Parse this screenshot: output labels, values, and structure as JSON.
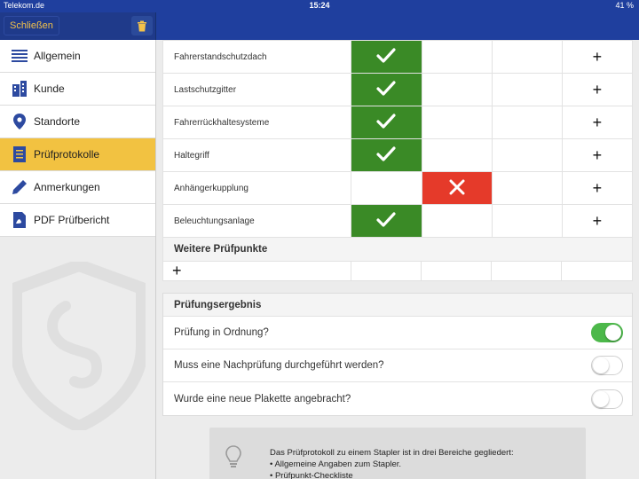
{
  "status": {
    "carrier": "Telekom.de",
    "time": "15:24",
    "battery": "41 %"
  },
  "nav": {
    "close_label": "Schließen"
  },
  "sidebar": {
    "items": [
      {
        "label": "Allgemein",
        "icon": "list-icon"
      },
      {
        "label": "Kunde",
        "icon": "building-icon"
      },
      {
        "label": "Standorte",
        "icon": "location-pin-icon"
      },
      {
        "label": "Prüfprotokolle",
        "icon": "document-icon",
        "active": true
      },
      {
        "label": "Anmerkungen",
        "icon": "pencil-icon"
      },
      {
        "label": "PDF Prüfbericht",
        "icon": "pdf-icon"
      }
    ]
  },
  "checklist": {
    "rows": [
      {
        "name": "Fahrerstandschutzdach",
        "result": "ok"
      },
      {
        "name": "Lastschutzgitter",
        "result": "ok"
      },
      {
        "name": "Fahrerrückhaltesysteme",
        "result": "ok"
      },
      {
        "name": "Haltegriff",
        "result": "ok"
      },
      {
        "name": "Anhängerkupplung",
        "result": "nok"
      },
      {
        "name": "Beleuchtungsanlage",
        "result": "ok"
      }
    ],
    "add_symbol": "+"
  },
  "extra": {
    "title": "Weitere Prüfpunkte",
    "add_symbol": "+"
  },
  "result": {
    "title": "Prüfungsergebnis",
    "rows": [
      {
        "label": "Prüfung in Ordnung?",
        "on": true
      },
      {
        "label": "Muss eine Nachprüfung durchgeführt werden?",
        "on": false
      },
      {
        "label": "Wurde eine neue Plakette angebracht?",
        "on": false
      }
    ]
  },
  "info": {
    "line1": "Das Prüfprotokoll zu einem Stapler ist in drei Bereiche gegliedert:",
    "line2": "• Allgemeine Angaben zum Stapler.",
    "line3": "• Prüfpunkt-Checkliste"
  },
  "colors": {
    "nav": "#1f3f9e",
    "accent": "#f2c241",
    "ok": "#3a8a26",
    "nok": "#e53a2a",
    "toggle_on": "#4cb84a"
  }
}
